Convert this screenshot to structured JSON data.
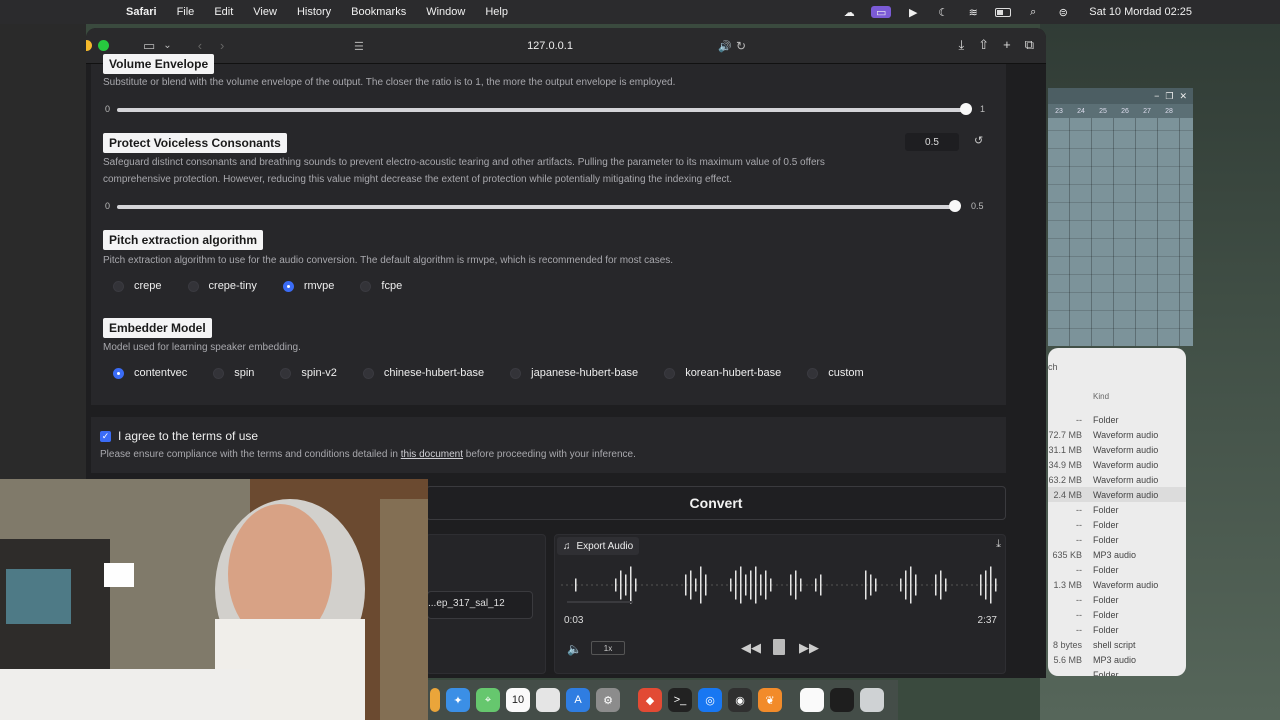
{
  "menubar": {
    "app": "Safari",
    "items": [
      "File",
      "Edit",
      "View",
      "History",
      "Bookmarks",
      "Window",
      "Help"
    ],
    "clock": "Sat 10 Mordad  02:25"
  },
  "browser": {
    "address": "127.0.0.1"
  },
  "volume_envelope": {
    "label": "Volume Envelope",
    "description": "Substitute or blend with the volume envelope of the output. The closer the ratio is to 1, the more the output envelope is employed.",
    "min": "0",
    "max": "1",
    "value": 1.0
  },
  "protect": {
    "label": "Protect Voiceless Consonants",
    "value_text": "0.5",
    "description_line1": "Safeguard distinct consonants and breathing sounds to prevent electro-acoustic tearing and other artifacts. Pulling the parameter to its maximum value of 0.5 offers",
    "description_line2": "comprehensive protection. However, reducing this value might decrease the extent of protection while potentially mitigating the indexing effect.",
    "min": "0",
    "max": "0.5",
    "value": 0.5
  },
  "pitch": {
    "label": "Pitch extraction algorithm",
    "description": "Pitch extraction algorithm to use for the audio conversion. The default algorithm is rmvpe, which is recommended for most cases.",
    "options": [
      "crepe",
      "crepe-tiny",
      "rmvpe",
      "fcpe"
    ],
    "selected": "rmvpe"
  },
  "embedder": {
    "label": "Embedder Model",
    "description": "Model used for learning speaker embedding.",
    "options": [
      "contentvec",
      "spin",
      "spin-v2",
      "chinese-hubert-base",
      "japanese-hubert-base",
      "korean-hubert-base",
      "custom"
    ],
    "selected": "contentvec"
  },
  "terms": {
    "checkbox_label": "I agree to the terms of use",
    "notice_before": "Please ensure compliance with the terms and conditions detailed in",
    "link": "this document",
    "notice_after": "before proceeding with your inference.",
    "checked": true
  },
  "convert_label": "Convert",
  "left_file_name": "...ep_317_sal_12",
  "audio": {
    "title": "Export Audio",
    "current_time": "0:03",
    "duration": "2:37",
    "speed": "1x",
    "progress": 0.02
  },
  "finder": {
    "search_fragment": "ch",
    "kind_header": "Kind",
    "rows": [
      {
        "size": "--",
        "kind": "Folder"
      },
      {
        "size": "72.7 MB",
        "kind": "Waveform audio"
      },
      {
        "size": "31.1 MB",
        "kind": "Waveform audio"
      },
      {
        "size": "34.9 MB",
        "kind": "Waveform audio"
      },
      {
        "size": "63.2 MB",
        "kind": "Waveform audio"
      },
      {
        "size": "2.4 MB",
        "kind": "Waveform audio"
      },
      {
        "size": "--",
        "kind": "Folder"
      },
      {
        "size": "--",
        "kind": "Folder"
      },
      {
        "size": "--",
        "kind": "Folder"
      },
      {
        "size": "635 KB",
        "kind": "MP3 audio"
      },
      {
        "size": "--",
        "kind": "Folder"
      },
      {
        "size": "1.3 MB",
        "kind": "Waveform audio"
      },
      {
        "size": "--",
        "kind": "Folder"
      },
      {
        "size": "--",
        "kind": "Folder"
      },
      {
        "size": "--",
        "kind": "Folder"
      },
      {
        "size": "8 bytes",
        "kind": "shell script"
      },
      {
        "size": "5.6 MB",
        "kind": "MP3 audio"
      },
      {
        "size": "",
        "kind": "Folder"
      }
    ]
  },
  "daw": {
    "ruler": [
      "23",
      "24",
      "25",
      "26",
      "27",
      "28"
    ]
  },
  "dock": {
    "calendar_day": "10"
  }
}
